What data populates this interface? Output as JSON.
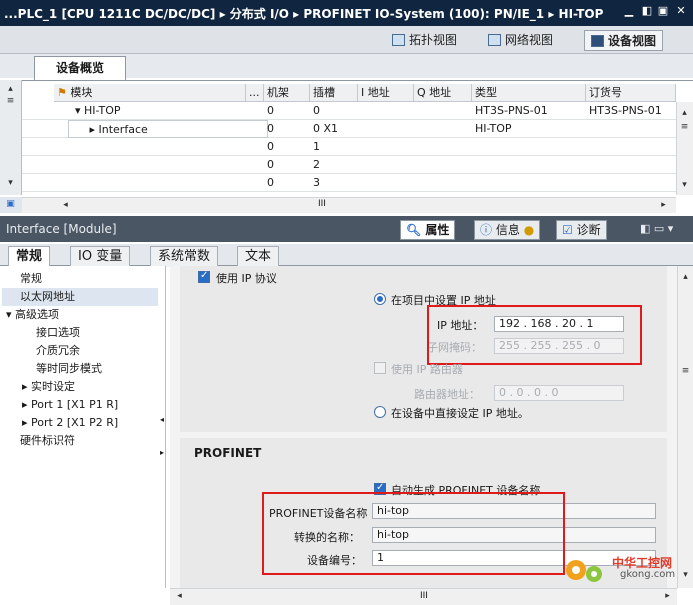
{
  "titlebar": {
    "path": "...PLC_1 [CPU 1211C DC/DC/DC]  ▸  分布式 I/O  ▸  PROFINET IO-System (100): PN/IE_1  ▸  HI-TOP"
  },
  "views": {
    "topology": "拓扑视图",
    "network": "网络视图",
    "device": "设备视图"
  },
  "overview_tab": "设备概览",
  "grid": {
    "headers": [
      "模块",
      "...",
      "机架",
      "插槽",
      "I 地址",
      "Q 地址",
      "类型",
      "订货号"
    ],
    "rows": [
      {
        "module": "HI-TOP",
        "rack": "0",
        "slot": "0",
        "type": "HT3S-PNS-01",
        "order": "HT3S-PNS-01"
      },
      {
        "module": "Interface",
        "rack": "0",
        "slot": "0 X1",
        "type": "HI-TOP",
        "order": ""
      },
      {
        "module": "",
        "rack": "0",
        "slot": "1",
        "type": "",
        "order": ""
      },
      {
        "module": "",
        "rack": "0",
        "slot": "2",
        "type": "",
        "order": ""
      },
      {
        "module": "",
        "rack": "0",
        "slot": "3",
        "type": "",
        "order": ""
      }
    ],
    "hscroll_thumb": "III"
  },
  "inspector": {
    "title": "Interface [Module]",
    "tabs": {
      "properties": "属性",
      "info": "信息",
      "diagnostics": "诊断"
    }
  },
  "subtabs": [
    "常规",
    "IO 变量",
    "系统常数",
    "文本"
  ],
  "nav": [
    {
      "label": "常规",
      "indent": 0
    },
    {
      "label": "以太网地址",
      "indent": 0,
      "selected": true
    },
    {
      "label": "▾ 高级选项",
      "indent": 0
    },
    {
      "label": "接口选项",
      "indent": 2
    },
    {
      "label": "介质冗余",
      "indent": 2
    },
    {
      "label": "等时同步模式",
      "indent": 2
    },
    {
      "label": "▸ 实时设定",
      "indent": 1
    },
    {
      "label": "▸ Port 1 [X1 P1 R]",
      "indent": 1
    },
    {
      "label": "▸ Port 2 [X1 P2 R]",
      "indent": 1
    },
    {
      "label": "硬件标识符",
      "indent": 0
    }
  ],
  "ethernet": {
    "use_ip": "使用 IP 协议",
    "set_in_project": "在项目中设置 IP 地址",
    "ip_label": "IP 地址：",
    "ip": [
      "192",
      "168",
      "20",
      "1"
    ],
    "mask_label": "子网掩码：",
    "mask": [
      "255",
      "255",
      "255",
      "0"
    ],
    "use_router": "使用 IP 路由器",
    "router_label": "路由器地址：",
    "router": [
      "0",
      "0",
      "0",
      "0"
    ],
    "set_on_device": "在设备中直接设定 IP 地址。"
  },
  "profinet": {
    "heading": "PROFINET",
    "auto_name": "自动生成 PROFINET 设备名称",
    "name_label": "PROFINET设备名称",
    "name_value": "hi-top",
    "converted_label": "转换的名称：",
    "converted_value": "hi-top",
    "number_label": "设备编号：",
    "number_value": "1"
  },
  "content_hscroll_thumb": "III",
  "watermark": {
    "line1": "中华工控网",
    "line2": "gkong.com"
  },
  "colors": {
    "titlebar": "#10253f",
    "highlight": "#e01a1a",
    "accent": "#2b6cc4"
  }
}
